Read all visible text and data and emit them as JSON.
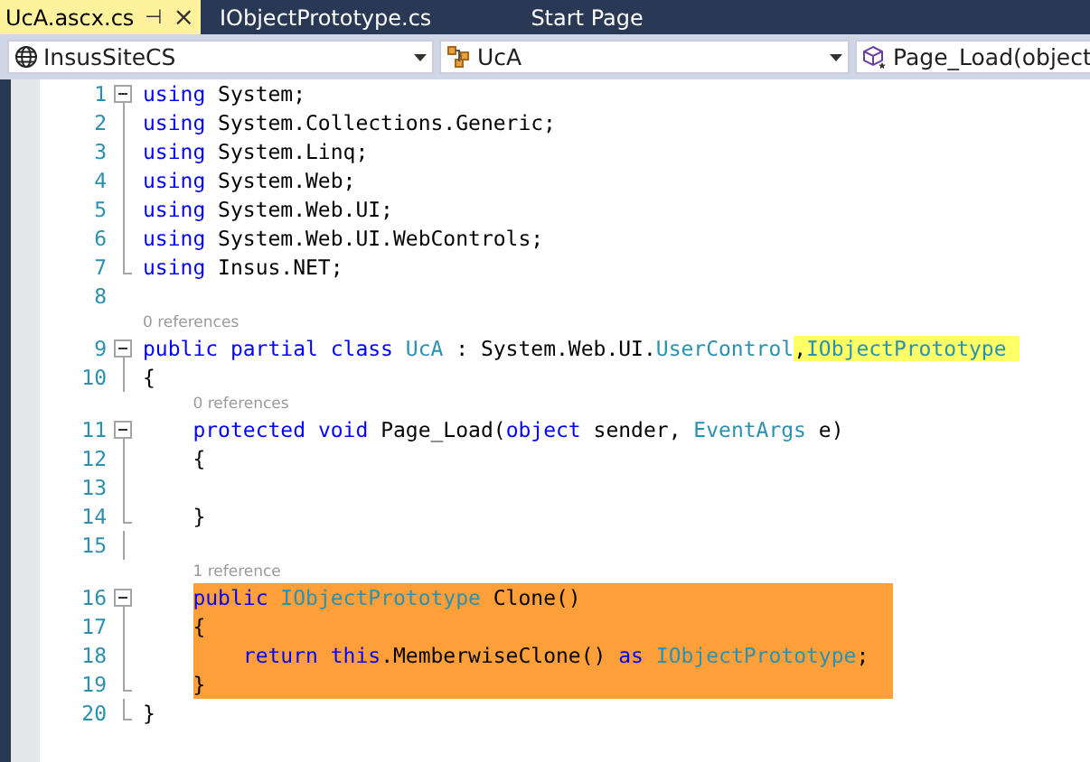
{
  "tabs": [
    {
      "label": "UcA.ascx.cs",
      "selected": true,
      "pin": "⊣",
      "close": "×"
    },
    {
      "label": "IObjectPrototype.cs",
      "selected": false
    },
    {
      "label": "Start Page",
      "selected": false
    }
  ],
  "navigation": [
    {
      "kind": "project",
      "value": "InsusSiteCS"
    },
    {
      "kind": "class",
      "value": "UcA"
    },
    {
      "kind": "member",
      "value": "Page_Load(object"
    }
  ],
  "lines": [
    {
      "number": "1",
      "kind": "start",
      "highlighted": false,
      "tokens": [
        {
          "text": "using",
          "kind": "keyword"
        },
        {
          "text": " System;",
          "kind": "plain"
        }
      ]
    },
    {
      "number": "2",
      "kind": "inside",
      "highlighted": false,
      "tokens": [
        {
          "text": "using",
          "kind": "keyword"
        },
        {
          "text": " System.Collections.Generic;",
          "kind": "plain"
        }
      ]
    },
    {
      "number": "3",
      "kind": "inside",
      "highlighted": false,
      "tokens": [
        {
          "text": "using",
          "kind": "keyword"
        },
        {
          "text": " System.Linq;",
          "kind": "plain"
        }
      ]
    },
    {
      "number": "4",
      "kind": "inside",
      "highlighted": false,
      "tokens": [
        {
          "text": "using",
          "kind": "keyword"
        },
        {
          "text": " System.Web;",
          "kind": "plain"
        }
      ]
    },
    {
      "number": "5",
      "kind": "inside",
      "highlighted": false,
      "tokens": [
        {
          "text": "using",
          "kind": "keyword"
        },
        {
          "text": " System.Web.UI;",
          "kind": "plain"
        }
      ]
    },
    {
      "number": "6",
      "kind": "inside",
      "highlighted": false,
      "tokens": [
        {
          "text": "using",
          "kind": "keyword"
        },
        {
          "text": " System.Web.UI.WebControls;",
          "kind": "plain"
        }
      ]
    },
    {
      "number": "7",
      "kind": "end",
      "highlighted": false,
      "tokens": [
        {
          "text": "using",
          "kind": "keyword"
        },
        {
          "text": " Insus.NET;",
          "kind": "plain"
        }
      ]
    },
    {
      "number": "8",
      "kind": "plain",
      "highlighted": false
    },
    {
      "number": "9",
      "kind": "start",
      "highlighted": false,
      "codelens": "0 references",
      "tokens": [
        {
          "text": "public partial class ",
          "kind": "keyword",
          "highlighted": false
        },
        {
          "text": "UcA",
          "kind": "type",
          "highlighted": false
        },
        {
          "text": " : System.Web.UI.",
          "kind": "plain",
          "highlighted": false
        },
        {
          "text": "UserControl",
          "kind": "type",
          "highlighted": false
        },
        {
          "text": ",",
          "kind": "plain",
          "highlighted": true
        },
        {
          "text": "IObjectPrototype ",
          "kind": "type",
          "highlighted": true
        }
      ]
    },
    {
      "number": "10",
      "kind": "inside",
      "highlighted": false,
      "tokens": [
        {
          "text": "{",
          "kind": "plain"
        }
      ]
    },
    {
      "number": "11",
      "kind": "start",
      "highlighted": false,
      "codelens": "0 references",
      "tokens": [
        {
          "text": "    protected void",
          "kind": "keyword"
        },
        {
          "text": " Page_Load(",
          "kind": "plain"
        },
        {
          "text": "object",
          "kind": "keyword"
        },
        {
          "text": " sender, ",
          "kind": "plain"
        },
        {
          "text": "EventArgs",
          "kind": "type"
        },
        {
          "text": " e)",
          "kind": "plain"
        }
      ]
    },
    {
      "number": "12",
      "kind": "inside",
      "highlighted": false,
      "tokens": [
        {
          "text": "    {",
          "kind": "plain"
        }
      ]
    },
    {
      "number": "13",
      "kind": "inside",
      "highlighted": false
    },
    {
      "number": "14",
      "kind": "end",
      "highlighted": false,
      "tokens": [
        {
          "text": "    }",
          "kind": "plain"
        }
      ]
    },
    {
      "number": "15",
      "kind": "inside",
      "highlighted": false
    },
    {
      "number": "16",
      "kind": "start",
      "highlighted": true,
      "codelens": "1 reference",
      "tokens": [
        {
          "text": "    public ",
          "kind": "keyword"
        },
        {
          "text": "IObjectPrototype",
          "kind": "type"
        },
        {
          "text": " Clone()",
          "kind": "plain"
        }
      ]
    },
    {
      "number": "17",
      "kind": "inside",
      "highlighted": true,
      "tokens": [
        {
          "text": "    {",
          "kind": "plain"
        }
      ]
    },
    {
      "number": "18",
      "kind": "inside",
      "highlighted": true,
      "tokens": [
        {
          "text": "        return this",
          "kind": "keyword"
        },
        {
          "text": ".MemberwiseClone() ",
          "kind": "plain"
        },
        {
          "text": "as ",
          "kind": "keyword"
        },
        {
          "text": "IObjectPrototype",
          "kind": "type"
        },
        {
          "text": ";",
          "kind": "plain"
        }
      ]
    },
    {
      "number": "19",
      "kind": "end",
      "highlighted": true,
      "tokens": [
        {
          "text": "    }",
          "kind": "plain"
        }
      ]
    },
    {
      "number": "20",
      "kind": "end",
      "highlighted": false,
      "tokens": [
        {
          "text": "}",
          "kind": "plain"
        }
      ]
    }
  ]
}
